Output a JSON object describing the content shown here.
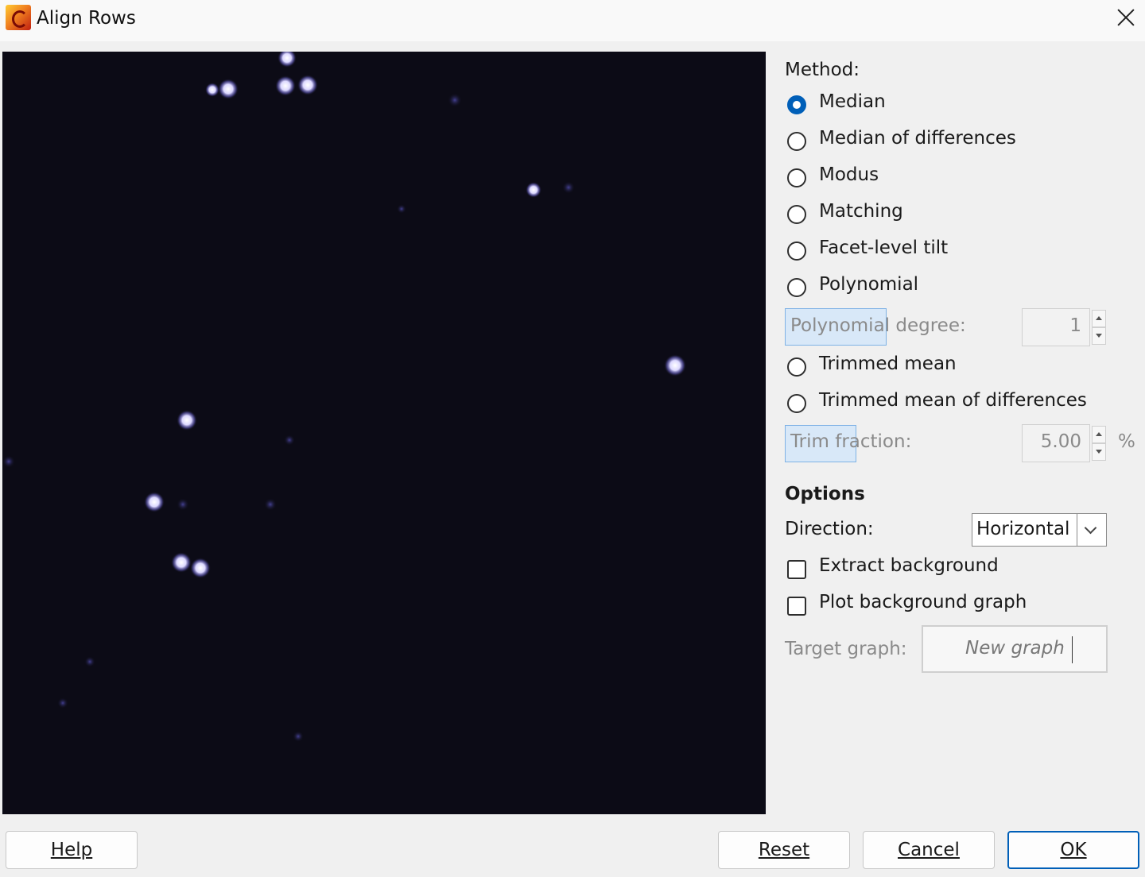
{
  "window": {
    "title": "Align Rows"
  },
  "method": {
    "label": "Method:",
    "options": [
      {
        "label": "Median",
        "checked": true
      },
      {
        "label": "Median of differences",
        "checked": false
      },
      {
        "label": "Modus",
        "checked": false
      },
      {
        "label": "Matching",
        "checked": false
      },
      {
        "label": "Facet-level tilt",
        "checked": false
      },
      {
        "label": "Polynomial",
        "checked": false
      }
    ],
    "polynomial_degree": {
      "label": "Polynomial degree:",
      "value": "1"
    },
    "options2": [
      {
        "label": "Trimmed mean",
        "checked": false
      },
      {
        "label": "Trimmed mean of differences",
        "checked": false
      }
    ],
    "trim_fraction": {
      "label": "Trim fraction:",
      "value": "5.00",
      "unit": "%"
    }
  },
  "options": {
    "heading": "Options",
    "direction": {
      "label": "Direction:",
      "value": "Horizontal"
    },
    "extract_background": {
      "label": "Extract background",
      "checked": false
    },
    "plot_background_graph": {
      "label": "Plot background graph",
      "checked": false
    },
    "target_graph": {
      "label": "Target graph:",
      "value": "New graph"
    }
  },
  "buttons": {
    "help": "Help",
    "reset": "Reset",
    "cancel": "Cancel",
    "ok": "OK"
  },
  "colors": {
    "accent": "#005fb8",
    "preview_bg": "#0c0b16",
    "spot": "#e8e6ff"
  }
}
